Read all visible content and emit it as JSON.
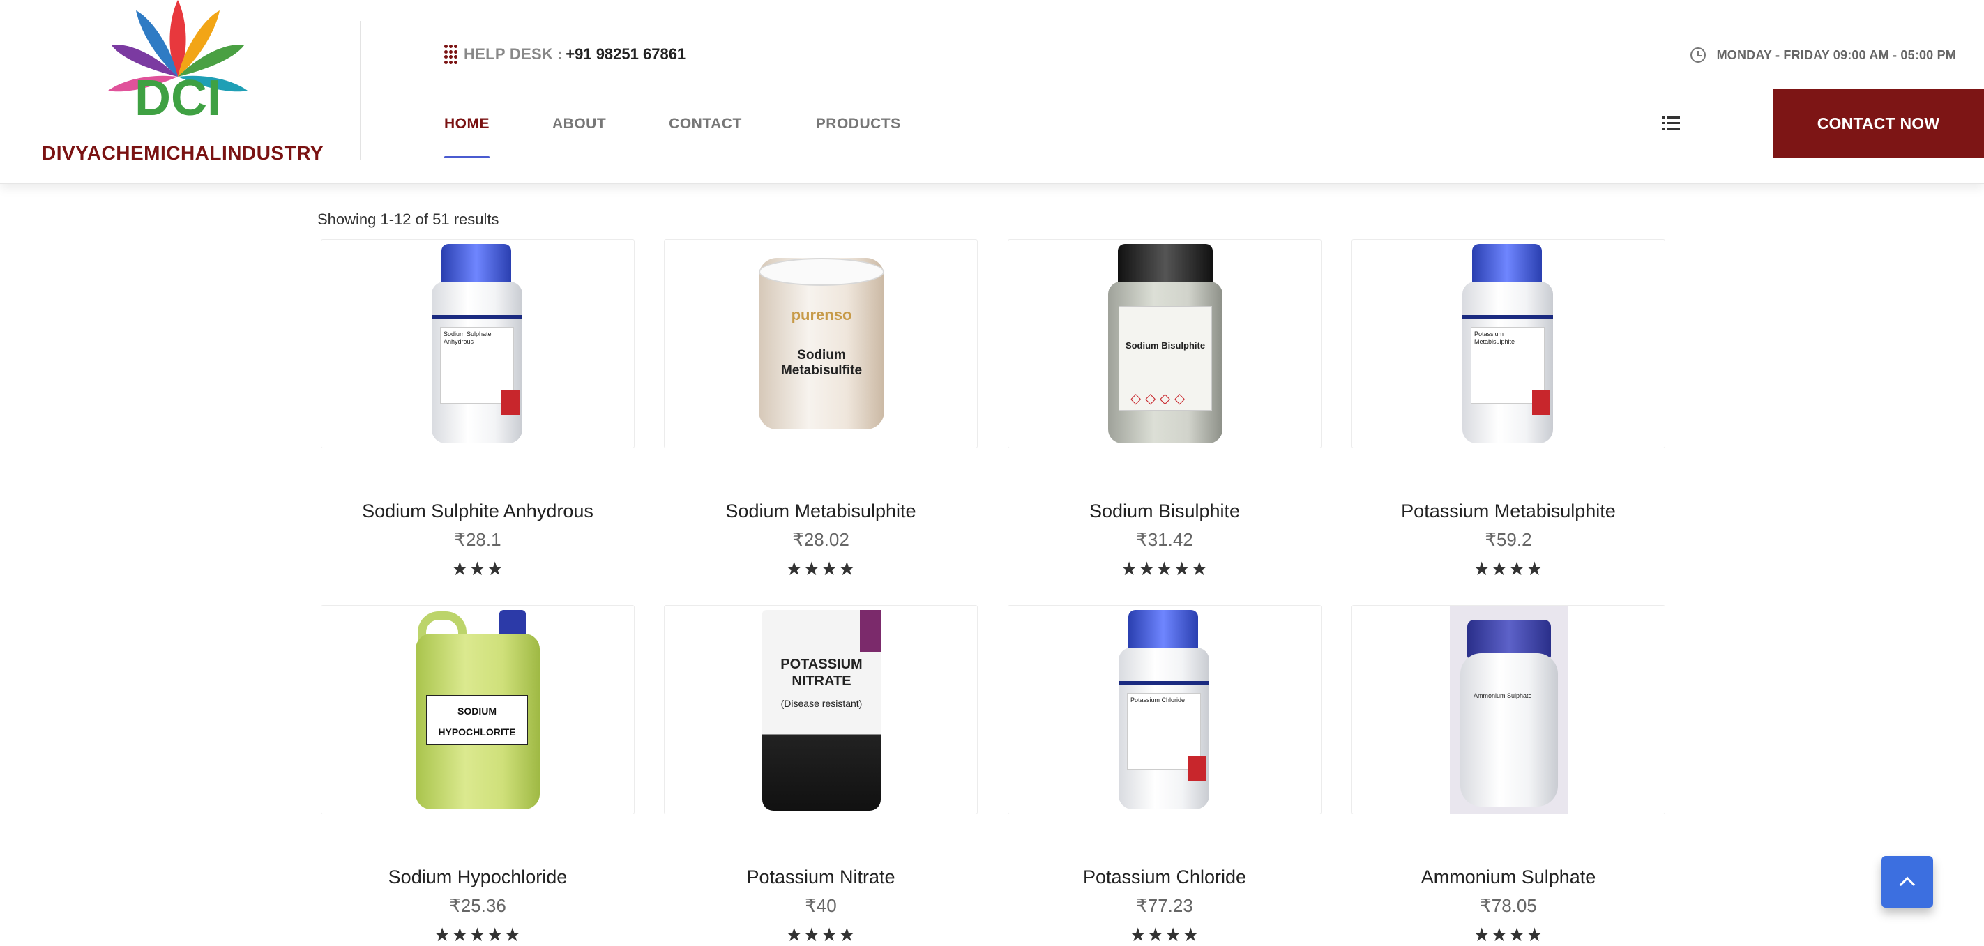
{
  "header": {
    "brand": "DIVYACHEMICHALINDUSTRY",
    "logo_text": "DCI",
    "helpdesk_label": "HELP DESK :",
    "helpdesk_phone": "+91 98251 67861",
    "hours": "MONDAY - FRIDAY 09:00 AM - 05:00 PM",
    "contact_button": "CONTACT NOW",
    "icons": {
      "helpdesk": "grid-dots-icon",
      "hours": "clock-icon",
      "menu": "list-icon"
    }
  },
  "nav": [
    {
      "label": "HOME",
      "active": true
    },
    {
      "label": "ABOUT",
      "active": false
    },
    {
      "label": "CONTACT",
      "active": false
    },
    {
      "label": "PRODUCTS",
      "active": false
    }
  ],
  "results_text": "Showing 1-12 of 51 results",
  "products": [
    {
      "name": "Sodium Sulphite Anhydrous",
      "price": "₹28.1",
      "rating": 3,
      "image_label": "Sodium Sulphate Anhydrous"
    },
    {
      "name": "Sodium Metabisulphite",
      "price": "₹28.02",
      "rating": 4,
      "image_label": "Sodium Metabisulfite",
      "image_brand": "purenso"
    },
    {
      "name": "Sodium Bisulphite",
      "price": "₹31.42",
      "rating": 5,
      "image_label": "Sodium Bisulphite"
    },
    {
      "name": "Potassium Metabisulphite",
      "price": "₹59.2",
      "rating": 4,
      "image_label": "Potassium Metabisulphite"
    },
    {
      "name": "Sodium Hypochloride",
      "price": "₹25.36",
      "rating": 5,
      "image_label": "SODIUM HYPOCHLORITE"
    },
    {
      "name": "Potassium Nitrate",
      "price": "₹40",
      "rating": 4,
      "image_label": "POTASSIUM NITRATE",
      "image_sub": "(Disease resistant)"
    },
    {
      "name": "Potassium Chloride",
      "price": "₹77.23",
      "rating": 4,
      "image_label": "Potassium Chloride"
    },
    {
      "name": "Ammonium Sulphate",
      "price": "₹78.05",
      "rating": 4,
      "image_label": "Ammonium Sulphate"
    }
  ],
  "colors": {
    "brand": "#7a1212",
    "accent": "#4a5bd0",
    "button": "#7d1515",
    "scroll_top": "#3c6fe0"
  }
}
